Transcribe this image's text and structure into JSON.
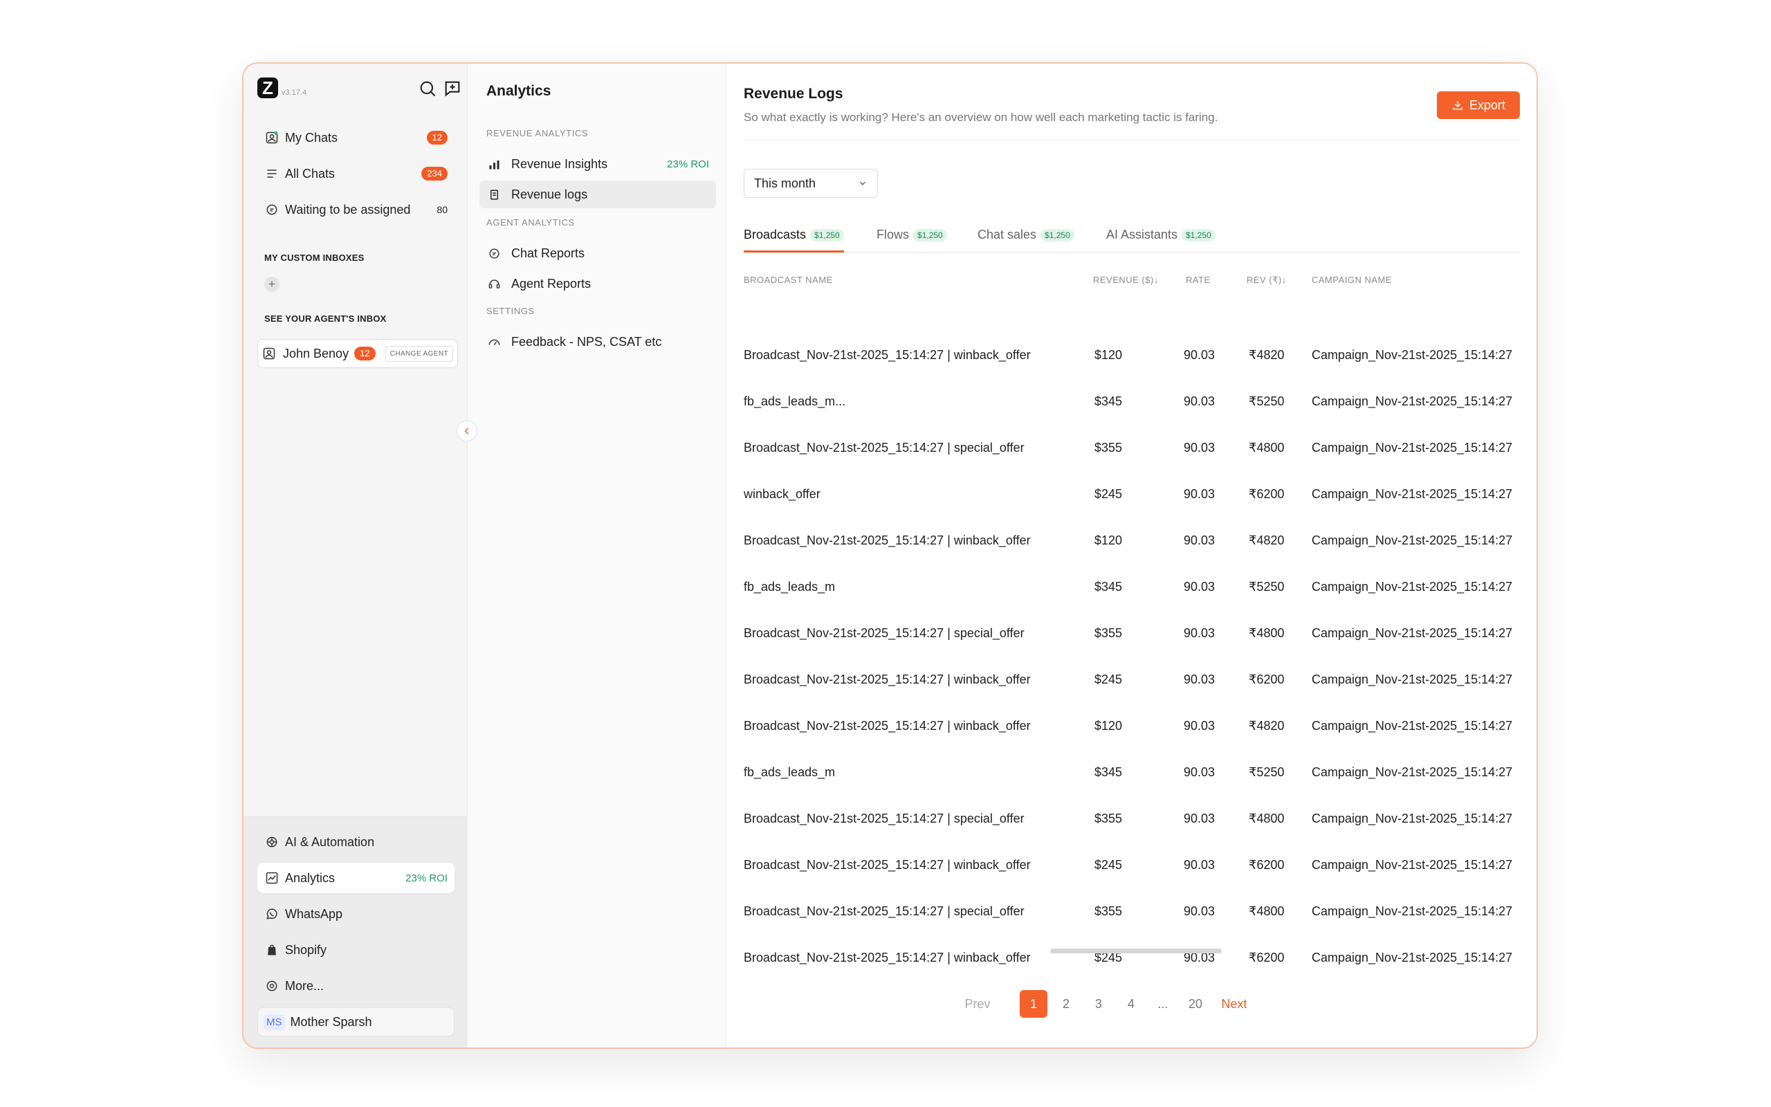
{
  "app": {
    "version": "v3.17.4",
    "logo_letter": "Z"
  },
  "sidebar": {
    "items": [
      {
        "label": "My Chats",
        "badge": "12"
      },
      {
        "label": "All Chats",
        "badge": "234"
      },
      {
        "label": "Waiting to be assigned",
        "count": "80"
      }
    ],
    "custom_inboxes_title": "MY CUSTOM INBOXES",
    "plus_label": "+",
    "agent_inbox_title": "SEE YOUR AGENT'S INBOX",
    "agent": {
      "name": "John Benoy",
      "badge": "12",
      "change_label": "CHANGE AGENT"
    },
    "bottom_items": [
      {
        "label": "AI & Automation"
      },
      {
        "label": "Analytics",
        "roi": "23%  ROI"
      },
      {
        "label": "WhatsApp"
      },
      {
        "label": "Shopify"
      },
      {
        "label": "More..."
      }
    ],
    "workspace": {
      "initials": "MS",
      "name": "Mother Sparsh"
    }
  },
  "analytics": {
    "title": "Analytics",
    "sections": [
      {
        "title": "REVENUE ANALYTICS",
        "items": [
          {
            "label": "Revenue Insights",
            "roi": "23%  ROI"
          },
          {
            "label": "Revenue logs"
          }
        ]
      },
      {
        "title": "AGENT ANALYTICS",
        "items": [
          {
            "label": "Chat Reports"
          },
          {
            "label": "Agent Reports"
          }
        ]
      },
      {
        "title": "SETTINGS",
        "items": [
          {
            "label": "Feedback - NPS, CSAT etc"
          }
        ]
      }
    ]
  },
  "main": {
    "title": "Revenue Logs",
    "subtitle": "So what exactly is working? Here's an overview on how well each marketing tactic is faring.",
    "export_label": "Export",
    "filter": "This month",
    "tabs": [
      {
        "label": "Broadcasts",
        "amount": "$1,250"
      },
      {
        "label": "Flows",
        "amount": "$1,250"
      },
      {
        "label": "Chat sales",
        "amount": "$1,250"
      },
      {
        "label": "AI Assistants",
        "amount": "$1,250"
      }
    ],
    "columns": [
      "BROADCAST NAME",
      "REVENUE ($)↓",
      "RATE",
      "REV (₹)↓",
      "CAMPAIGN NAME"
    ],
    "rows": [
      [
        "Broadcast_Nov-21st-2025_15:14:27 | winback_offer",
        "$120",
        "90.03",
        "₹4820",
        "Campaign_Nov-21st-2025_15:14:27"
      ],
      [
        "fb_ads_leads_m...",
        "$345",
        "90.03",
        "₹5250",
        "Campaign_Nov-21st-2025_15:14:27"
      ],
      [
        "Broadcast_Nov-21st-2025_15:14:27 | special_offer",
        "$355",
        "90.03",
        "₹4800",
        "Campaign_Nov-21st-2025_15:14:27"
      ],
      [
        "winback_offer",
        "$245",
        "90.03",
        "₹6200",
        "Campaign_Nov-21st-2025_15:14:27"
      ],
      [
        "Broadcast_Nov-21st-2025_15:14:27 | winback_offer",
        "$120",
        "90.03",
        "₹4820",
        "Campaign_Nov-21st-2025_15:14:27"
      ],
      [
        "fb_ads_leads_m",
        "$345",
        "90.03",
        "₹5250",
        "Campaign_Nov-21st-2025_15:14:27"
      ],
      [
        "Broadcast_Nov-21st-2025_15:14:27 | special_offer",
        "$355",
        "90.03",
        "₹4800",
        "Campaign_Nov-21st-2025_15:14:27"
      ],
      [
        "Broadcast_Nov-21st-2025_15:14:27 | winback_offer",
        "$245",
        "90.03",
        "₹6200",
        "Campaign_Nov-21st-2025_15:14:27"
      ],
      [
        "Broadcast_Nov-21st-2025_15:14:27 | winback_offer",
        "$120",
        "90.03",
        "₹4820",
        "Campaign_Nov-21st-2025_15:14:27"
      ],
      [
        "fb_ads_leads_m",
        "$345",
        "90.03",
        "₹5250",
        "Campaign_Nov-21st-2025_15:14:27"
      ],
      [
        "Broadcast_Nov-21st-2025_15:14:27 | special_offer",
        "$355",
        "90.03",
        "₹4800",
        "Campaign_Nov-21st-2025_15:14:27"
      ],
      [
        "Broadcast_Nov-21st-2025_15:14:27 | winback_offer",
        "$245",
        "90.03",
        "₹6200",
        "Campaign_Nov-21st-2025_15:14:27"
      ],
      [
        "Broadcast_Nov-21st-2025_15:14:27 | special_offer",
        "$355",
        "90.03",
        "₹4800",
        "Campaign_Nov-21st-2025_15:14:27"
      ],
      [
        "Broadcast_Nov-21st-2025_15:14:27 | winback_offer",
        "$245",
        "90.03",
        "₹6200",
        "Campaign_Nov-21st-2025_15:14:27"
      ]
    ],
    "pagination": {
      "prev": "Prev",
      "pages": [
        "1",
        "2",
        "3",
        "4",
        "...",
        "20"
      ],
      "current": "1",
      "next": "Next"
    }
  },
  "colors": {
    "accent": "#f15a24",
    "roi_green": "#1b9c5a",
    "border_peach": "#f6c3ad"
  },
  "icons": [
    "search-icon",
    "new-chat-icon",
    "user-icon",
    "list-icon",
    "chat-icon",
    "plus-icon",
    "chevron-left-icon",
    "ai-icon",
    "chart-icon",
    "whatsapp-icon",
    "shopify-icon",
    "more-icon",
    "bar-chart-icon",
    "document-icon",
    "message-icon",
    "agent-icon",
    "gauge-icon",
    "download-icon",
    "chevron-down-icon"
  ]
}
